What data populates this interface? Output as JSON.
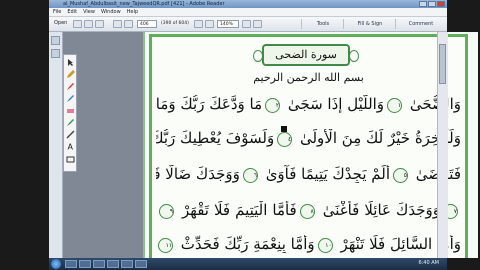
{
  "window": {
    "title": "al_Mushaf_Abdulbasit_new_TajweedQR.pdf [421] - Adobe Reader"
  },
  "menu": [
    "File",
    "Edit",
    "View",
    "Window",
    "Help"
  ],
  "toolbar": {
    "open_label": "Open",
    "page_number": "406",
    "page_range": "(390 of 604)",
    "zoom": "140%",
    "tabs": [
      "Tools",
      "Fill & Sign",
      "Comment"
    ]
  },
  "quran": {
    "surah_title": "سورة الضحى",
    "basmala": "بسم الله الرحمن الرحيم",
    "lines": [
      {
        "segments": [
          {
            "text": "وَالضُّحَىٰ"
          },
          {
            "mark": "١"
          },
          {
            "text": "وَاللَّيْلِ إِذَا سَجَىٰ"
          },
          {
            "mark": "٢"
          },
          {
            "text": "مَا وَدَّعَكَ رَبُّكَ وَمَا قَلَىٰ"
          },
          {
            "mark": "٣"
          }
        ]
      },
      {
        "segments": [
          {
            "text": "وَلَلْآخِرَةُ خَيْرٌ لَكَ مِنَ الْأُولَىٰ"
          },
          {
            "mark": "٤"
          },
          {
            "text": "وَلَسَوْفَ يُعْطِيكَ رَبُّكَ"
          }
        ]
      },
      {
        "segments": [
          {
            "text": "فَتَرْضَىٰ"
          },
          {
            "mark": "٥"
          },
          {
            "text": "أَلَمْ يَجِدْكَ يَتِيمًا فَآوَىٰ"
          },
          {
            "mark": "٦"
          },
          {
            "text": "وَوَجَدَكَ ضَالًّا فَهَدَىٰ"
          }
        ]
      },
      {
        "segments": [
          {
            "mark": "٧"
          },
          {
            "text": "وَوَجَدَكَ عَائِلًا فَأَغْنَىٰ"
          },
          {
            "mark": "٨"
          },
          {
            "text": "فَأَمَّا الْيَتِيمَ فَلَا تَقْهَرْ"
          },
          {
            "mark": "٩"
          }
        ]
      },
      {
        "segments": [
          {
            "text": "وَأَمَّا السَّائِلَ فَلَا تَنْهَرْ"
          },
          {
            "mark": "١٠"
          },
          {
            "text": "وَأَمَّا بِنِعْمَةِ رَبِّكَ فَحَدِّثْ"
          },
          {
            "mark": "١١"
          }
        ]
      }
    ]
  },
  "taskbar": {
    "clock": "6:40 AM"
  }
}
